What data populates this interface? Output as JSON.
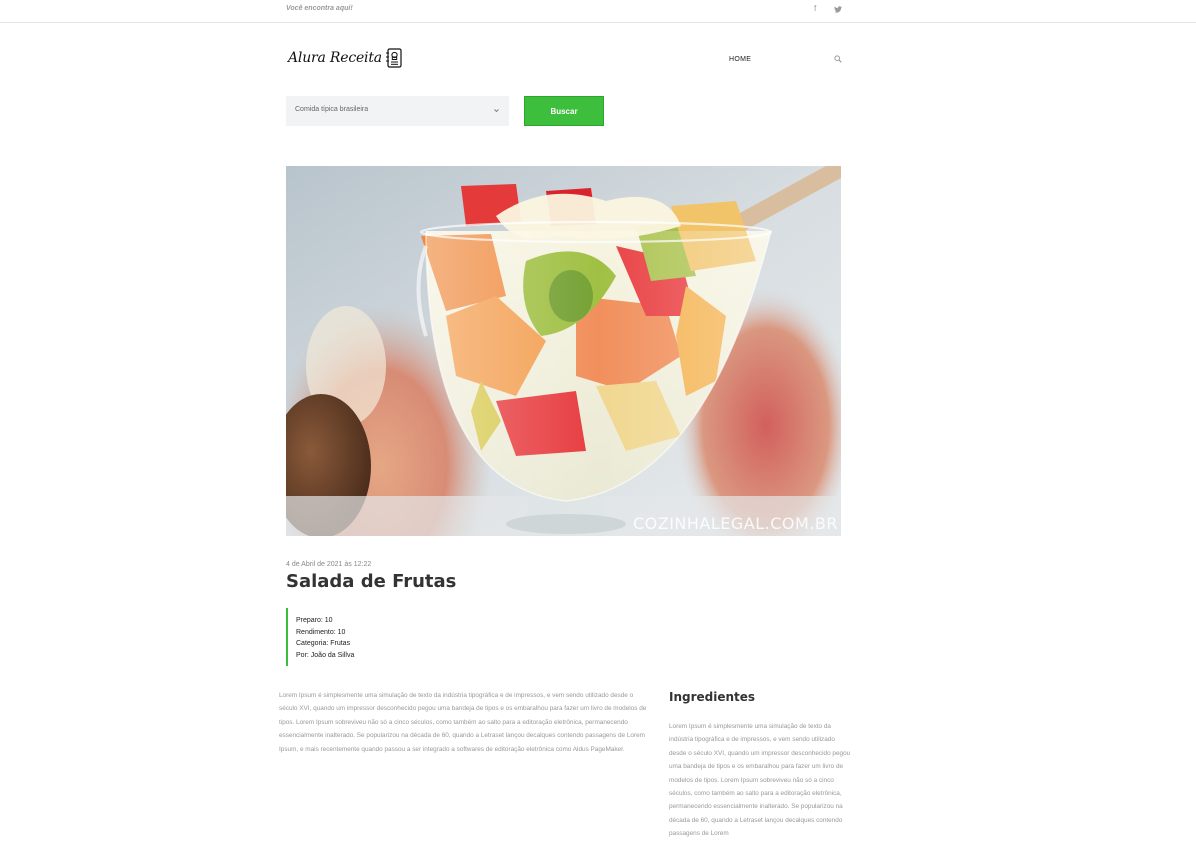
{
  "topbar": {
    "tagline": "Você encontra aqui!",
    "social": [
      {
        "icon": "facebook-icon",
        "glyph": "f"
      },
      {
        "icon": "twitter-icon",
        "glyph": "⌣"
      }
    ]
  },
  "header": {
    "logo_text": "Alura Receita",
    "logo_icon": "cookbook-icon",
    "nav_home": "HOME",
    "search_icon": "search-icon"
  },
  "search": {
    "selected_value": "Comida típica brasileira",
    "button_label": "Buscar"
  },
  "hero": {
    "watermark": "COZINHALEGAL.COM.BR"
  },
  "post": {
    "date": "4 de Abril de 2021 às 12:22",
    "title": "Salada de Frutas",
    "meta": {
      "preparo": "Preparo: 10",
      "rendimento": "Rendimento: 10",
      "categoria": "Categoria: Frutas",
      "autor": "Por: João da Sillva"
    },
    "body": "Lorem Ipsum é simplesmente uma simulação de texto da indústria tipográfica e de impressos, e vem sendo utilizado desde o século XVI, quando um impressor desconhecido pegou uma bandeja de tipos e os embaralhou para fazer um livro de modelos de tipos. Lorem Ipsum sobreviveu não só a cinco séculos, como também ao salto para a editoração eletrônica, permanecendo essencialmente inalterado. Se popularizou na década de 60, quando a Letraset lançou decalques contendo passagens de Lorem Ipsum, e mais recentemente quando passou a ser integrado a softwares de editoração eletrônica como Aldus PageMaker."
  },
  "ingredients": {
    "title": "Ingredientes",
    "text": "Lorem Ipsum é simplesmente uma simulação de texto da indústria tipográfica e de impressos, e vem sendo utilizado desde o século XVI, quando um impressor desconhecido pegou uma bandeja de tipos e os embaralhou para fazer um livro de modelos de tipos. Lorem Ipsum sobreviveu não só a cinco séculos, como também ao salto para a editoração eletrônica, permanecendo essencialmente inalterado. Se popularizou na década de 60, quando a Letraset lançou decalques contendo passagens de Lorem"
  },
  "colors": {
    "accent": "#3dbf3d",
    "select_bg": "#f2f3f5",
    "muted_text": "#999999"
  }
}
